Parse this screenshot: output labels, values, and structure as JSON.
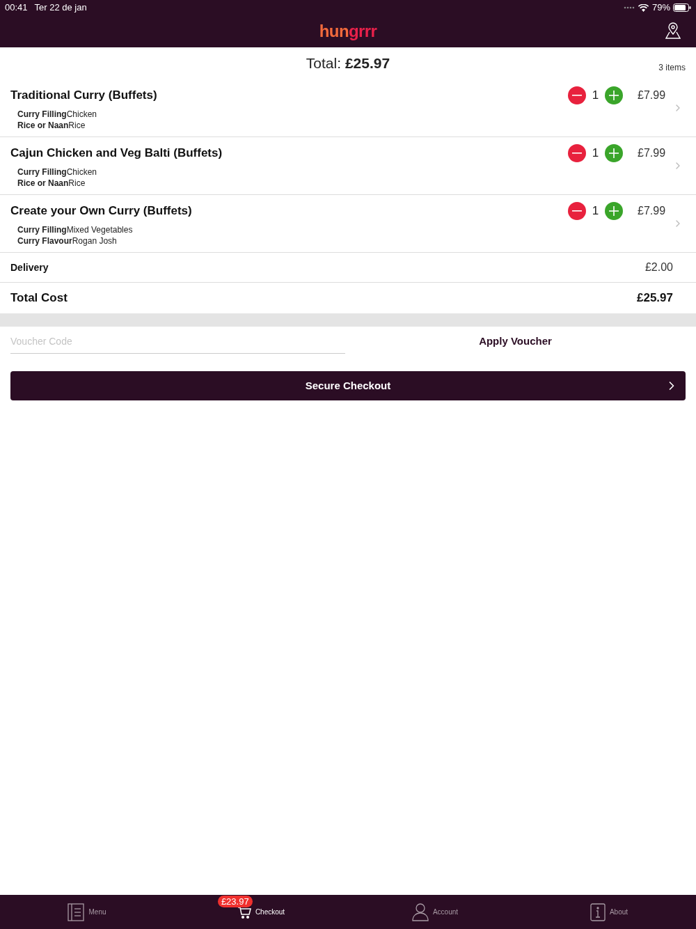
{
  "status_bar": {
    "time": "00:41",
    "date": "Ter 22 de jan",
    "battery": "79%"
  },
  "header": {
    "logo": [
      "hun",
      "grrr"
    ]
  },
  "summary": {
    "total_label": "Total:",
    "total": "£25.97",
    "count": "3 items"
  },
  "items": [
    {
      "name": "Traditional Curry (Buffets)",
      "options": [
        {
          "label": "Curry Filling",
          "value": "Chicken"
        },
        {
          "label": "Rice or Naan",
          "value": "Rice"
        }
      ],
      "quantity": "1",
      "price": "£7.99"
    },
    {
      "name": "Cajun Chicken and Veg Balti (Buffets)",
      "options": [
        {
          "label": "Curry Filling",
          "value": "Chicken"
        },
        {
          "label": "Rice or Naan",
          "value": "Rice"
        }
      ],
      "quantity": "1",
      "price": "£7.99"
    },
    {
      "name": "Create your Own Curry (Buffets)",
      "options": [
        {
          "label": "Curry Filling",
          "value": "Mixed Vegetables"
        },
        {
          "label": "Curry Flavour",
          "value": "Rogan Josh"
        }
      ],
      "quantity": "1",
      "price": "£7.99"
    }
  ],
  "delivery": {
    "label": "Delivery",
    "value": "£2.00"
  },
  "total_cost": {
    "label": "Total Cost",
    "value": "£25.97"
  },
  "voucher": {
    "placeholder": "Voucher Code",
    "button": "Apply Voucher"
  },
  "checkout_button": "Secure Checkout",
  "tab_bar": [
    {
      "kind": "menu",
      "label": "Menu",
      "selected": false
    },
    {
      "kind": "cart",
      "label": "Checkout",
      "selected": true,
      "badge": "£23.97"
    },
    {
      "kind": "account",
      "label": "Account",
      "selected": false
    },
    {
      "kind": "about",
      "label": "About",
      "selected": false
    }
  ]
}
